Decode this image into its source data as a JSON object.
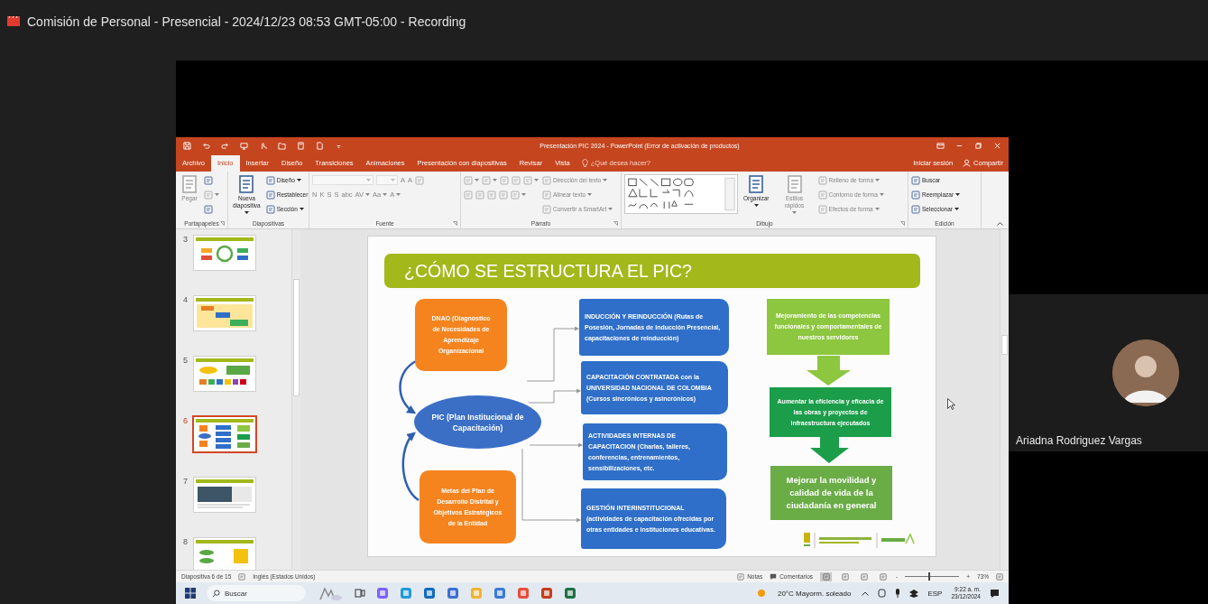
{
  "meeting": {
    "title": "Comisión de Personal - Presencial - 2024/12/23 08:53 GMT-05:00 - Recording"
  },
  "powerpoint": {
    "title": "Presentación PIC 2024 - PowerPoint (Error de activación de productos)",
    "tabs": [
      {
        "label": "Archivo",
        "selected": false
      },
      {
        "label": "Inicio",
        "selected": true
      },
      {
        "label": "Insertar",
        "selected": false
      },
      {
        "label": "Diseño",
        "selected": false
      },
      {
        "label": "Transiciones",
        "selected": false
      },
      {
        "label": "Animaciones",
        "selected": false
      },
      {
        "label": "Presentación con diapositivas",
        "selected": false
      },
      {
        "label": "Revisar",
        "selected": false
      },
      {
        "label": "Vista",
        "selected": false
      }
    ],
    "tell_me": {
      "placeholder": "¿Qué desea hacer?"
    },
    "account": "Iniciar sesión",
    "share": "Compartir",
    "ribbon": {
      "groups": [
        {
          "label": "Portapapeles",
          "launcher": true,
          "columns": [
            [
              [
                {
                  "kind": "large",
                  "label": "Pegar",
                  "dropdown": false,
                  "disabled": true
                }
              ]
            ],
            [
              [
                {
                  "kind": "icon",
                  "dropdown": false,
                  "disabled": false
                }
              ],
              [
                {
                  "kind": "icon",
                  "dropdown": true,
                  "disabled": true
                }
              ],
              [
                {
                  "kind": "icon",
                  "dropdown": false,
                  "disabled": false
                }
              ]
            ]
          ]
        },
        {
          "label": "Diapositivas",
          "launcher": false,
          "columns": [
            [
              [
                {
                  "kind": "large",
                  "label": "Nueva diapositiva",
                  "dropdown": true,
                  "disabled": false
                }
              ]
            ],
            [
              [
                {
                  "kind": "small",
                  "label": "Diseño",
                  "dropdown": true,
                  "disabled": false
                }
              ],
              [
                {
                  "kind": "small",
                  "label": "Restablecer",
                  "dropdown": false,
                  "disabled": false
                }
              ],
              [
                {
                  "kind": "small",
                  "label": "Sección",
                  "dropdown": true,
                  "disabled": false
                }
              ]
            ]
          ]
        },
        {
          "label": "Fuente",
          "launcher": true,
          "columns": [
            [
              [
                {
                  "kind": "field",
                  "wide": true,
                  "disabled": true
                },
                {
                  "kind": "field",
                  "wide": false,
                  "disabled": true
                },
                {
                  "kind": "text",
                  "label": "A",
                  "dropdown": false,
                  "disabled": true
                },
                {
                  "kind": "text",
                  "label": "A",
                  "dropdown": false,
                  "disabled": true
                },
                {
                  "kind": "icon",
                  "dropdown": false,
                  "disabled": true
                }
              ],
              [
                {
                  "kind": "text",
                  "label": "N",
                  "dropdown": false,
                  "disabled": true
                },
                {
                  "kind": "text",
                  "label": "K",
                  "dropdown": false,
                  "disabled": true
                },
                {
                  "kind": "text",
                  "label": "S",
                  "dropdown": false,
                  "disabled": true
                },
                {
                  "kind": "text",
                  "label": "S",
                  "dropdown": false,
                  "disabled": true
                },
                {
                  "kind": "text",
                  "label": "abc",
                  "dropdown": false,
                  "disabled": true
                },
                {
                  "kind": "text",
                  "label": "AV",
                  "dropdown": true,
                  "disabled": true
                },
                {
                  "kind": "text",
                  "label": "Aa",
                  "dropdown": true,
                  "disabled": true
                },
                {
                  "kind": "text",
                  "label": "A",
                  "dropdown": true,
                  "disabled": true
                }
              ]
            ]
          ]
        },
        {
          "label": "Párrafo",
          "launcher": true,
          "columns": [
            [
              [
                {
                  "kind": "icon",
                  "dropdown": true,
                  "disabled": true
                },
                {
                  "kind": "icon",
                  "dropdown": true,
                  "disabled": true
                },
                {
                  "kind": "icon",
                  "dropdown": false,
                  "disabled": true
                },
                {
                  "kind": "icon",
                  "dropdown": false,
                  "disabled": true
                },
                {
                  "kind": "icon",
                  "dropdown": true,
                  "disabled": true
                }
              ],
              [
                {
                  "kind": "icon",
                  "dropdown": false,
                  "disabled": true
                },
                {
                  "kind": "icon",
                  "dropdown": false,
                  "disabled": true
                },
                {
                  "kind": "icon",
                  "dropdown": false,
                  "disabled": true
                },
                {
                  "kind": "icon",
                  "dropdown": false,
                  "disabled": true
                },
                {
                  "kind": "icon",
                  "dropdown": true,
                  "disabled": true
                }
              ]
            ],
            [
              [
                {
                  "kind": "small",
                  "label": "Dirección del texto",
                  "dropdown": true,
                  "disabled": true
                }
              ],
              [
                {
                  "kind": "small",
                  "label": "Alinear texto",
                  "dropdown": true,
                  "disabled": true
                }
              ],
              [
                {
                  "kind": "small",
                  "label": "Convertir a SmartArt",
                  "dropdown": true,
                  "disabled": true
                }
              ]
            ]
          ]
        },
        {
          "label": "Dibujo",
          "launcher": true,
          "columns": [
            [
              [
                {
                  "kind": "gallery",
                  "disabled": false
                }
              ]
            ],
            [
              [
                {
                  "kind": "large",
                  "label": "Organizar",
                  "dropdown": true,
                  "disabled": false
                }
              ]
            ],
            [
              [
                {
                  "kind": "large",
                  "label": "Estilos rápidos",
                  "dropdown": true,
                  "disabled": true
                }
              ]
            ],
            [
              [
                {
                  "kind": "small",
                  "label": "Relleno de forma",
                  "dropdown": true,
                  "disabled": true
                }
              ],
              [
                {
                  "kind": "small",
                  "label": "Contorno de forma",
                  "dropdown": true,
                  "disabled": true
                }
              ],
              [
                {
                  "kind": "small",
                  "label": "Efectos de forma",
                  "dropdown": true,
                  "disabled": true
                }
              ]
            ]
          ]
        },
        {
          "label": "Edición",
          "launcher": false,
          "columns": [
            [
              [
                {
                  "kind": "small",
                  "label": "Buscar",
                  "dropdown": false,
                  "disabled": false
                }
              ],
              [
                {
                  "kind": "small",
                  "label": "Reemplazar",
                  "dropdown": true,
                  "disabled": false
                }
              ],
              [
                {
                  "kind": "small",
                  "label": "Seleccionar",
                  "dropdown": true,
                  "disabled": false
                }
              ]
            ]
          ]
        }
      ]
    },
    "thumbnails": [
      {
        "number": "3",
        "kind": "cycle",
        "selected": false
      },
      {
        "number": "4",
        "kind": "steps",
        "selected": false
      },
      {
        "number": "5",
        "kind": "process",
        "selected": false
      },
      {
        "number": "6",
        "kind": "diagram",
        "selected": true
      },
      {
        "number": "7",
        "kind": "photo",
        "selected": false
      },
      {
        "number": "8",
        "kind": "list",
        "selected": false
      }
    ],
    "slide": {
      "title": "¿CÓMO SE ESTRUCTURA EL PIC?",
      "nodes": [
        {
          "kind": "box",
          "color": "#f5841f",
          "text": "DNAO (Diagnóstico de Necesidades de Aprendizaje Organizacional"
        },
        {
          "kind": "ellipse",
          "color": "#3b6fc6",
          "text": "PIC (Plan Institucional de Capacitación)"
        },
        {
          "kind": "box",
          "color": "#f5841f",
          "text": "Metas del Plan de Desarrollo Distrital y Objetivos Estratégicos de la Entidad"
        },
        {
          "kind": "tab",
          "color": "#2f6fc9",
          "text": "INDUCCIÓN Y REINDUCCIÓN (Rutas de Posesión, Jornadas de Inducción Presencial, capacitaciones de reinducción)"
        },
        {
          "kind": "tab",
          "color": "#2f6fc9",
          "text": "CAPACITACIÓN CONTRATADA con la UNIVERSIDAD NACIONAL DE COLOMBIA (Cursos sincrónicos y asincrónicos)"
        },
        {
          "kind": "tab",
          "color": "#2f6fc9",
          "text": "ACTIVIDADES INTERNAS DE CAPACITACION (Charlas, talleres, conferencias, entrenamientos, sensibilizaciones, etc."
        },
        {
          "kind": "tab",
          "color": "#2f6fc9",
          "text": "GESTIÓN INTERINSTITUCIONAL (actividades de capacitación ofrecidas por otras entidades e instituciones educativas."
        },
        {
          "kind": "goal",
          "color": "#8dc63f",
          "text": "Mejoramiento de las competencias funcionales y comportamentales de nuestros servidores"
        },
        {
          "kind": "goal",
          "color": "#1b9d4a",
          "text": "Aumentar la eficiencia y eficacia de las obras y proyectos de infraestructura ejecutados"
        },
        {
          "kind": "goal",
          "color": "#6aac46",
          "text": "Mejorar la movilidad y calidad de vida de la ciudadanía en general"
        }
      ]
    },
    "status_bar": {
      "slide_info": "Diapositiva 6 de 15",
      "language": "Inglés (Estados Unidos)",
      "notes": "Notas",
      "comments": "Comentarios",
      "views": [
        {
          "selected": true
        },
        {
          "selected": false
        },
        {
          "selected": false
        },
        {
          "selected": false
        }
      ],
      "zoom_out": "-",
      "zoom_in": "+",
      "zoom": {
        "level": 0.45,
        "reading": "73%"
      }
    }
  },
  "taskbar": {
    "search": {
      "placeholder": "Buscar"
    },
    "weather": "20°C Mayorm. soleado",
    "language": "ESP",
    "time": "9:22 a. m.",
    "date": "23/12/2024"
  },
  "participant": {
    "name": "Ariadna Rodriguez Vargas"
  }
}
